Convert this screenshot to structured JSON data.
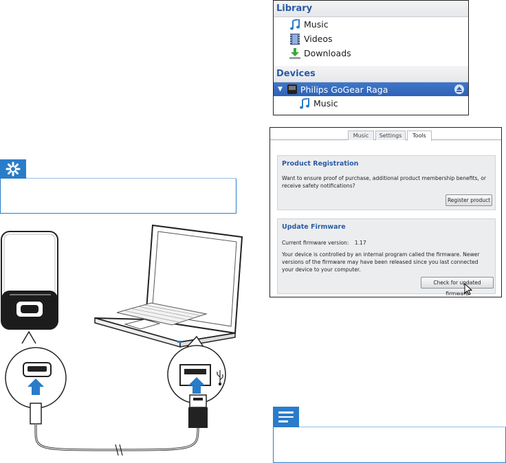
{
  "library": {
    "header": "Library",
    "items": [
      {
        "label": "Music",
        "icon": "music-note-icon"
      },
      {
        "label": "Videos",
        "icon": "film-icon"
      },
      {
        "label": "Downloads",
        "icon": "download-icon"
      }
    ]
  },
  "devices": {
    "header": "Devices",
    "device_name": "Philips GoGear Raga",
    "sub_items": [
      {
        "label": "Music",
        "icon": "music-note-icon"
      }
    ]
  },
  "tools": {
    "tabs": [
      {
        "label": "Music",
        "active": false
      },
      {
        "label": "Settings",
        "active": false
      },
      {
        "label": "Tools",
        "active": true
      }
    ],
    "product_registration": {
      "title": "Product Registration",
      "text": "Want to ensure proof of purchase, additional product membership benefits, or receive safety notifications?",
      "button": "Register product"
    },
    "update_firmware": {
      "title": "Update Firmware",
      "version_label": "Current firmware version:",
      "version_value": "1.17",
      "text": "Your device is controlled by an internal program called the firmware. Newer versions of the firmware may have been released since you last connected your device to your computer.",
      "button": "Check for updated firmware"
    }
  },
  "colors": {
    "accent_blue": "#2a7cc9",
    "selection_blue": "#2f63b7",
    "header_text_blue": "#2a5ba6"
  }
}
